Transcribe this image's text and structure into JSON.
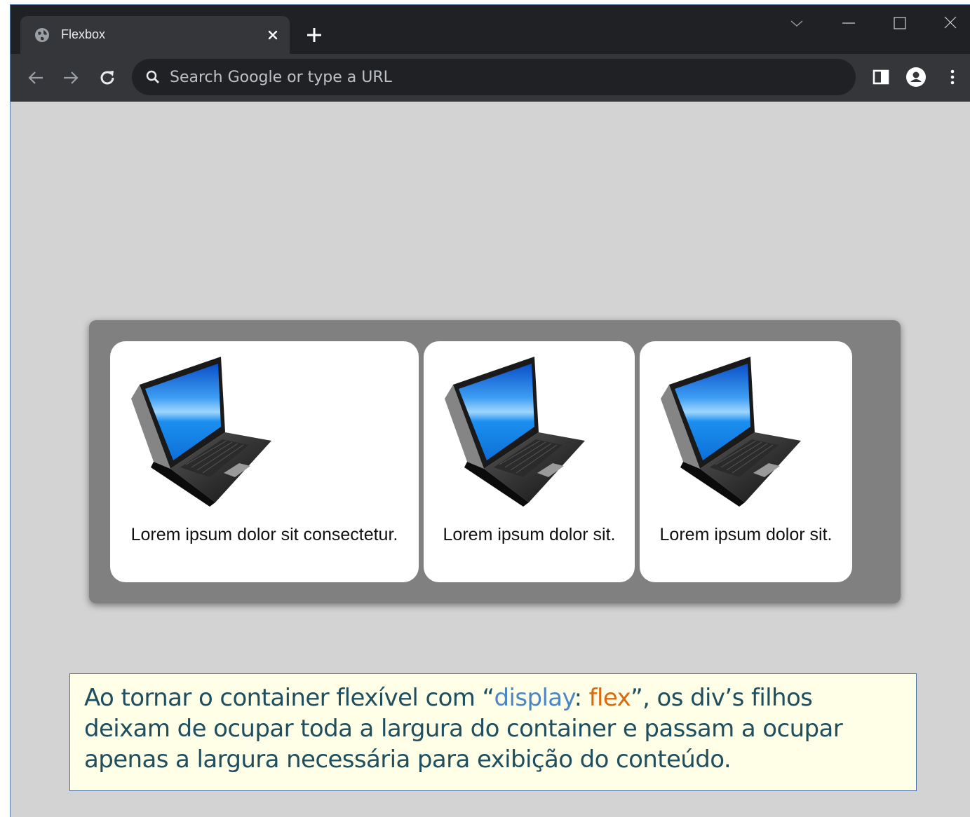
{
  "browser": {
    "tab": {
      "title": "Flexbox",
      "icon": "globe-icon"
    },
    "window_controls": [
      "tab-search-icon",
      "minimize-icon",
      "maximize-icon",
      "close-icon"
    ],
    "toolbar": {
      "omnibox_placeholder": "Search Google or type a URL",
      "icons": [
        "back-icon",
        "forward-icon",
        "reload-icon",
        "search-icon",
        "side-panel-icon",
        "profile-icon",
        "menu-icon"
      ]
    }
  },
  "page": {
    "cards": [
      {
        "image": "laptop-image",
        "caption": "Lorem ipsum dolor sit consectetur."
      },
      {
        "image": "laptop-image",
        "caption": "Lorem ipsum dolor sit."
      },
      {
        "image": "laptop-image",
        "caption": "Lorem ipsum dolor sit."
      }
    ],
    "note": {
      "prefix": "Ao tornar o container flexível com “",
      "property": "display",
      "colon": ": ",
      "value": "flex",
      "suffix": "”, os div’s filhos deixam de ocupar toda a largura do container e passam a ocupar apenas a largura necessária para exibição do conteúdo."
    }
  },
  "colors": {
    "page_background": "#d3d3d3",
    "container": "#808080",
    "note_background": "#fffee6",
    "note_text": "#1f4e5f",
    "note_property": "#4a86c8",
    "note_value": "#d96a10"
  }
}
